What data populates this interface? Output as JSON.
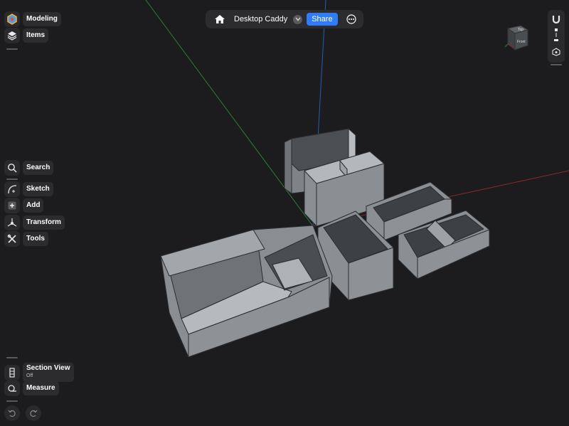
{
  "document": {
    "title": "Desktop Caddy"
  },
  "topbar": {
    "share_label": "Share"
  },
  "sidebar": {
    "modeling": "Modeling",
    "items": "Items",
    "search": "Search",
    "sketch": "Sketch",
    "add": "Add",
    "transform": "Transform",
    "tools": "Tools"
  },
  "bottom": {
    "section_view": "Section View",
    "section_view_state": "Off",
    "measure": "Measure"
  },
  "view_cube": {
    "top": "Top",
    "front": "Front"
  },
  "colors": {
    "accent": "#2f7cf6",
    "background": "#1c1c1e",
    "model": "#8e9297"
  }
}
